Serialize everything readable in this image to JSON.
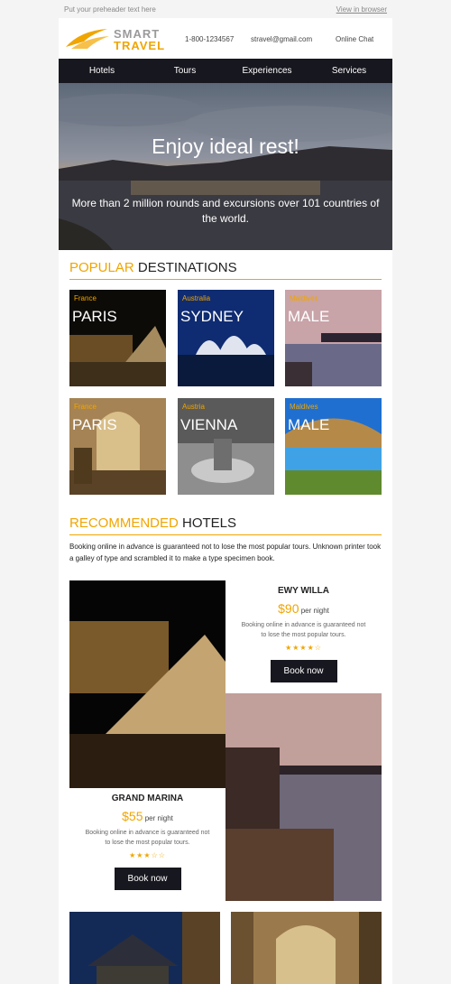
{
  "preheader": {
    "text": "Put your preheader text here",
    "view_link": "View in browser"
  },
  "header": {
    "logo_top": "SMART",
    "logo_bottom": "TRAVEL",
    "phone": "1-800-1234567",
    "email": "stravel@gmail.com",
    "chat": "Online Chat"
  },
  "nav": {
    "items": [
      "Hotels",
      "Tours",
      "Experiences",
      "Services"
    ]
  },
  "hero": {
    "title": "Enjoy ideal rest!",
    "subtitle": "More than 2 million rounds and excursions over 101 countries of the world."
  },
  "popular": {
    "title_accent": "POPULAR",
    "title_rest": "DESTINATIONS",
    "items": [
      {
        "country": "France",
        "city": "PARIS"
      },
      {
        "country": "Australia",
        "city": "SYDNEY"
      },
      {
        "country": "Maldives",
        "city": "MALE"
      },
      {
        "country": "France",
        "city": "PARIS"
      },
      {
        "country": "Austria",
        "city": "VIENNA"
      },
      {
        "country": "Maldives",
        "city": "MALE"
      }
    ]
  },
  "recommended": {
    "title_accent": "RECOMMENDED",
    "title_rest": "HOTELS",
    "intro": "Booking online in advance is guaranteed not to lose the most popular tours. Unknown printer took a galley of type and scrambled it to make a type specimen book.",
    "hotels": [
      {
        "name": "EWY WILLA",
        "currency": "$",
        "price": "90",
        "per": "per night",
        "desc": "Booking online in advance is guaranteed not to lose the most popular tours.",
        "stars": "★★★★☆",
        "button": "Book now"
      },
      {
        "name": "GRAND MARINA",
        "currency": "$",
        "price": "55",
        "per": "per night",
        "desc": "Booking online in advance is guaranteed not to lose the most popular tours.",
        "stars": "★★★☆☆",
        "button": "Book now"
      }
    ]
  }
}
